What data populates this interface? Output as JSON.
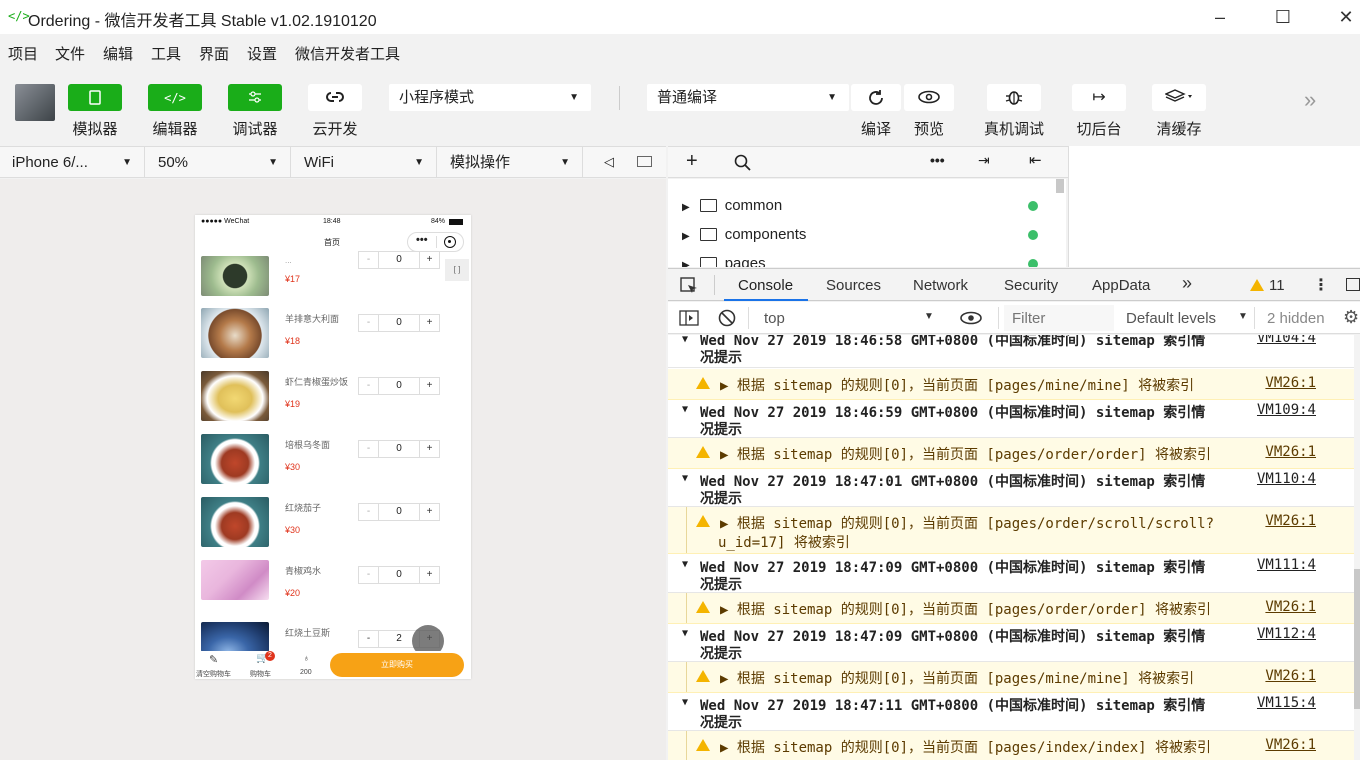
{
  "window": {
    "title": "Ordering - 微信开发者工具 Stable v1.02.1910120",
    "logo": "</>"
  },
  "menu": [
    "项目",
    "文件",
    "编辑",
    "工具",
    "界面",
    "设置",
    "微信开发者工具"
  ],
  "toolbar": {
    "simulator": "模拟器",
    "editor": "编辑器",
    "debugger": "调试器",
    "cloud": "云开发",
    "mode": "小程序模式",
    "compile_mode": "普通编译",
    "compile": "编译",
    "preview": "预览",
    "device_debug": "真机调试",
    "background": "切后台",
    "clear_cache": "清缓存"
  },
  "simbar": {
    "device": "iPhone 6/...",
    "zoom": "50%",
    "network": "WiFi",
    "simulate": "模拟操作"
  },
  "phone": {
    "carrier": "●●●●● WeChat",
    "time": "18:48",
    "battery": "84%",
    "page_title": "首页",
    "partial_name": "...",
    "partial_price": "¥17",
    "foods": [
      {
        "name": "羊排意大利面",
        "price": "¥18",
        "qty": "0",
        "color": "#b47a4a"
      },
      {
        "name": "虾仁青椒蛋炒饭",
        "price": "¥19",
        "qty": "0",
        "color": "#e0c05a"
      },
      {
        "name": "培根乌冬面",
        "price": "¥30",
        "qty": "0",
        "color": "#3f7f86"
      },
      {
        "name": "红烧茄子",
        "price": "¥30",
        "qty": "0",
        "color": "#3f7f86"
      },
      {
        "name": "青椒鸡水",
        "price": "¥20",
        "qty": "0",
        "color": "#e9b6dd"
      },
      {
        "name": "红烧土豆斯",
        "price": "",
        "qty": "2",
        "color": "#1e3a6a"
      }
    ],
    "partial_qty": "0",
    "tab_clear": "清空购物车",
    "tab_cart": "购物车",
    "cart_badge": "2",
    "total": "200",
    "buy": "立即购买"
  },
  "filetree": [
    "common",
    "components",
    "pages"
  ],
  "devtools": {
    "tabs": [
      "Console",
      "Sources",
      "Network",
      "Security",
      "AppData"
    ],
    "more": "»",
    "warn_count": "11",
    "context": "top",
    "filter_placeholder": "Filter",
    "levels": "Default levels",
    "hidden": "2 hidden"
  },
  "console": [
    {
      "type": "log",
      "text": "Wed Nov 27 2019 18:46:58 GMT+0800 (中国标准时间) sitemap 索引情",
      "text2": "况提示",
      "src": "VM104:4"
    },
    {
      "type": "warn",
      "text": "▶ 根据 sitemap 的规则[0]，当前页面 [pages/mine/mine] 将被索引",
      "text2": "",
      "src": "VM26:1"
    },
    {
      "type": "log",
      "text": "Wed Nov 27 2019 18:46:59 GMT+0800 (中国标准时间) sitemap 索引情",
      "text2": "况提示",
      "src": "VM109:4"
    },
    {
      "type": "warn",
      "text": "▶ 根据 sitemap 的规则[0]，当前页面 [pages/order/order] 将被索引",
      "text2": "",
      "src": "VM26:1"
    },
    {
      "type": "log",
      "text": "Wed Nov 27 2019 18:47:01 GMT+0800 (中国标准时间) sitemap 索引情",
      "text2": "况提示",
      "src": "VM110:4"
    },
    {
      "type": "warn",
      "text": "▶ 根据 sitemap 的规则[0]，当前页面 [pages/order/scroll/scroll?",
      "text2": "u_id=17] 将被索引",
      "src": "VM26:1"
    },
    {
      "type": "log",
      "text": "Wed Nov 27 2019 18:47:09 GMT+0800 (中国标准时间) sitemap 索引情",
      "text2": "况提示",
      "src": "VM111:4"
    },
    {
      "type": "warn",
      "text": "▶ 根据 sitemap 的规则[0]，当前页面 [pages/order/order] 将被索引",
      "text2": "",
      "src": "VM26:1"
    },
    {
      "type": "log",
      "text": "Wed Nov 27 2019 18:47:09 GMT+0800 (中国标准时间) sitemap 索引情",
      "text2": "况提示",
      "src": "VM112:4"
    },
    {
      "type": "warn",
      "text": "▶ 根据 sitemap 的规则[0]，当前页面 [pages/mine/mine] 将被索引",
      "text2": "",
      "src": "VM26:1"
    },
    {
      "type": "log",
      "text": "Wed Nov 27 2019 18:47:11 GMT+0800 (中国标准时间) sitemap 索引情",
      "text2": "况提示",
      "src": "VM115:4"
    },
    {
      "type": "warn",
      "text": "▶ 根据 sitemap 的规则[0]，当前页面 [pages/index/index] 将被索引",
      "text2": "",
      "src": "VM26:1"
    }
  ]
}
